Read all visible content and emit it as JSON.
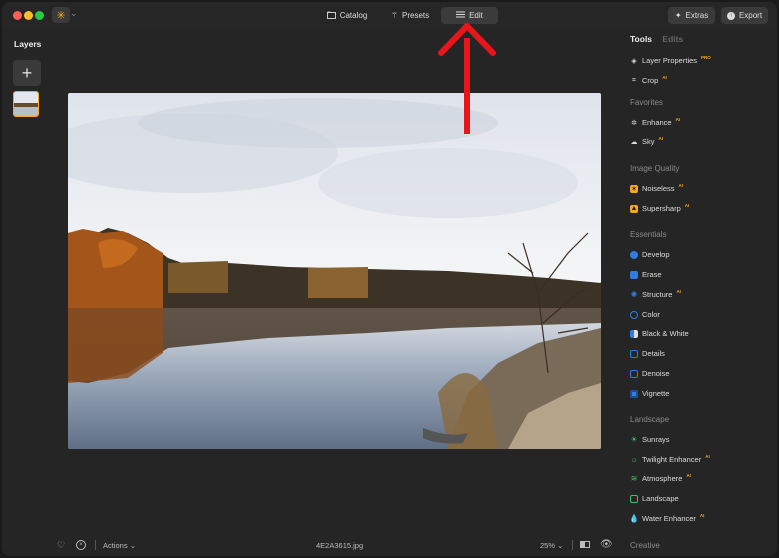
{
  "titlebar": {
    "tabs": [
      {
        "label": "Catalog",
        "icon": "folder-icon"
      },
      {
        "label": "Presets",
        "icon": "wand-icon"
      },
      {
        "label": "Edit",
        "icon": "sliders-icon"
      }
    ],
    "extras_label": "Extras",
    "export_label": "Export"
  },
  "layers": {
    "title": "Layers"
  },
  "panel": {
    "tab_tools": "Tools",
    "tab_edits": "Edits",
    "top_items": [
      {
        "label": "Layer Properties",
        "badge": "PRO"
      },
      {
        "label": "Crop",
        "badge": "AI"
      }
    ],
    "sections": {
      "favorites": "Favorites",
      "image_quality": "Image Quality",
      "essentials": "Essentials",
      "landscape": "Landscape",
      "creative": "Creative"
    },
    "favorites": [
      {
        "label": "Enhance",
        "badge": "AI"
      },
      {
        "label": "Sky",
        "badge": "AI"
      }
    ],
    "image_quality": [
      {
        "label": "Noiseless",
        "badge": "AI"
      },
      {
        "label": "Supersharp",
        "badge": "AI"
      }
    ],
    "essentials": [
      {
        "label": "Develop",
        "badge": ""
      },
      {
        "label": "Erase",
        "badge": ""
      },
      {
        "label": "Structure",
        "badge": "AI"
      },
      {
        "label": "Color",
        "badge": ""
      },
      {
        "label": "Black & White",
        "badge": ""
      },
      {
        "label": "Details",
        "badge": ""
      },
      {
        "label": "Denoise",
        "badge": ""
      },
      {
        "label": "Vignette",
        "badge": ""
      }
    ],
    "landscape": [
      {
        "label": "Sunrays",
        "badge": ""
      },
      {
        "label": "Twilight Enhancer",
        "badge": "AI"
      },
      {
        "label": "Atmosphere",
        "badge": "AI"
      },
      {
        "label": "Landscape",
        "badge": ""
      },
      {
        "label": "Water Enhancer",
        "badge": "AI"
      }
    ]
  },
  "bottombar": {
    "actions_label": "Actions",
    "filename": "4E2A3615.jpg",
    "zoom": "25%"
  },
  "colors": {
    "accent": "#f5a623",
    "arrow": "#e8151b"
  }
}
